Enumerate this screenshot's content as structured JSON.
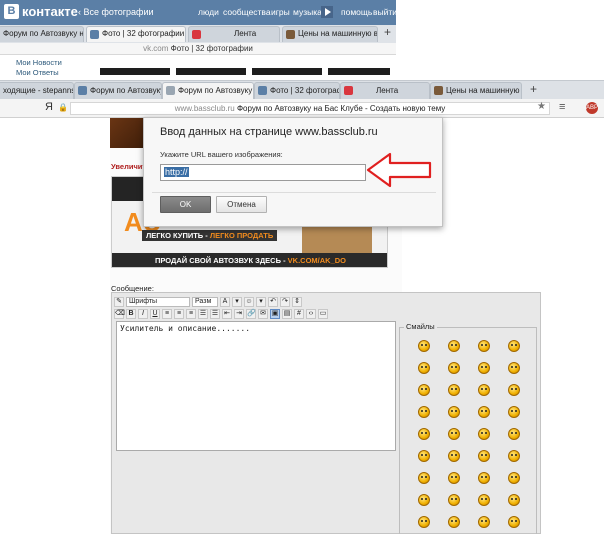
{
  "vk": {
    "logo_text": "контакте",
    "logo_badge": "В",
    "back_link": "‹  Все фотографии",
    "nav": [
      "люди",
      "сообщества",
      "игры",
      "музыка",
      "помощь",
      "выйти"
    ],
    "tabs": [
      "Форум по Автозвуку на Бас",
      "Фото | 32 фотографии",
      "Лента",
      "Цены на машинную вышив"
    ],
    "address_domain": "vk.com",
    "address_title": "Фото | 32 фотографии",
    "side_items": [
      "Мои Новости",
      "Мои Ответы"
    ]
  },
  "front": {
    "tabs": [
      "ходящие - stepannsk@",
      "Форум по Автозвуку на Бас",
      "Форум по Автозвуку на Бас",
      "Фото | 32 фотографии",
      "Лента",
      "Цены на машинную выши"
    ],
    "address_domain": "www.bassclub.ru",
    "address_title": "Форум по Автозвуку на Бас Клубе - Создать новую тему",
    "browser_logo": "Я",
    "lock_icon": "🔒",
    "star_icon": "★",
    "menu_icon": "≡",
    "ext_badge": "ABP"
  },
  "page": {
    "enlarge_text": "Увеличить",
    "banner_big": "AU",
    "banner_line1_a": "ЛЕГКО КУПИТЬ - ",
    "banner_line1_b": "ЛЕГКО ПРОДАТЬ",
    "banner_bottom_a": "ПРОДАЙ СВОЙ АВТОЗВУК ЗДЕСЬ - ",
    "banner_bottom_b": "VK.COM/AK_DO",
    "message_label": "Сообщение:",
    "font_dropdown": "Шрифты",
    "size_dropdown": "Разм",
    "tool_b": "B",
    "tool_i": "I",
    "tool_u": "U",
    "editor_text": "Усилитель и описание.......",
    "smiles_title": "Смайлы"
  },
  "dialog": {
    "title": "Ввод данных на странице www.bassclub.ru",
    "label": "Укажите URL вашего изображения:",
    "input_value": "http://",
    "ok": "OK",
    "cancel": "Отмена"
  },
  "colors": {
    "vk_blue": "#5b7fa6",
    "arrow_red": "#e02020",
    "ok_gray": "#7a7a7a"
  }
}
